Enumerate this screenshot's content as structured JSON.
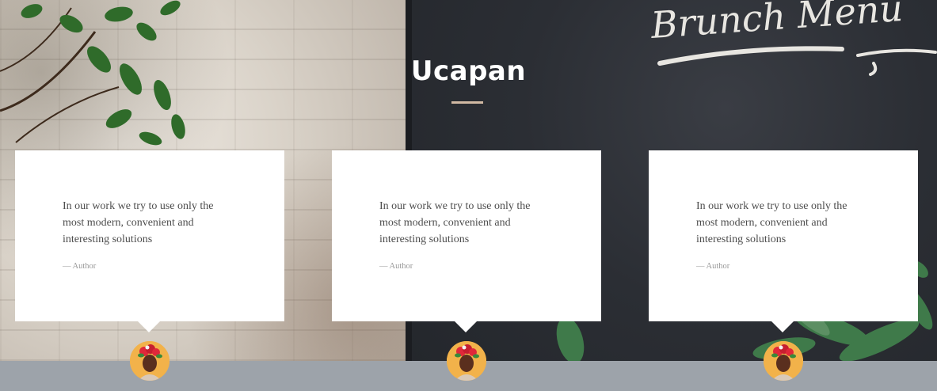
{
  "section": {
    "title": "Ucapan"
  },
  "testimonials": [
    {
      "quote": "In our work we try to use only the most modern, convenient and interesting solutions",
      "author": "— Author"
    },
    {
      "quote": "In our work we try to use only the most modern, convenient and interesting solutions",
      "author": "— Author"
    },
    {
      "quote": "In our work we try to use only the most modern, convenient and interesting solutions",
      "author": "— Author"
    }
  ],
  "background": {
    "chalkboard_text": "Brunch Menu"
  },
  "colors": {
    "title_text": "#ffffff",
    "title_rule": "#d1b9a3",
    "card_bg": "#ffffff",
    "quote_text": "#4d4d4d",
    "author_text": "#9a9a9a",
    "footer_bg": "#9da3aa",
    "avatar_bg": "#f2b24a"
  },
  "icons": {
    "avatar": "person-avatar-icon"
  }
}
